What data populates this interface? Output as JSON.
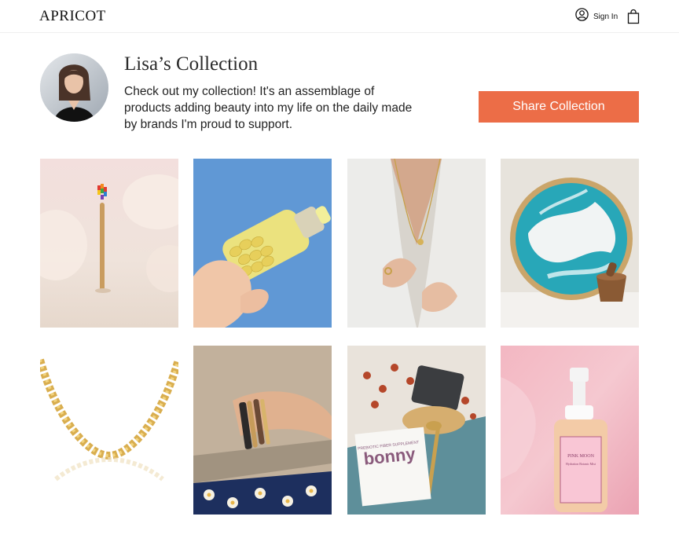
{
  "header": {
    "logo": "APRICOT",
    "sign_in_label": "Sign In",
    "icons": {
      "account": "user-circle-icon",
      "cart": "shopping-bag-icon"
    }
  },
  "collection": {
    "title": "Lisa’s Collection",
    "description": "Check out my collection! It's an assemblage of products adding beauty into my life on the daily made by brands I'm proud to support.",
    "share_button_label": "Share Collection"
  },
  "products": [
    {
      "name": "bamboo-toothbrush"
    },
    {
      "name": "vitamin-bottle"
    },
    {
      "name": "initial-necklace"
    },
    {
      "name": "resin-tray"
    },
    {
      "name": "gold-chain-necklace"
    },
    {
      "name": "beaded-bracelets"
    },
    {
      "name": "fiber-supplement",
      "label_small": "PREBIOTIC FIBER SUPPLEMENT",
      "label_brand": "bonny"
    },
    {
      "name": "mist-bottle",
      "label_brand": "PINK MOON",
      "label_small": "Hydration Botanic Mist"
    }
  ],
  "colors": {
    "accent": "#ec6d47",
    "text": "#1c1c1c",
    "border": "#efefef"
  }
}
